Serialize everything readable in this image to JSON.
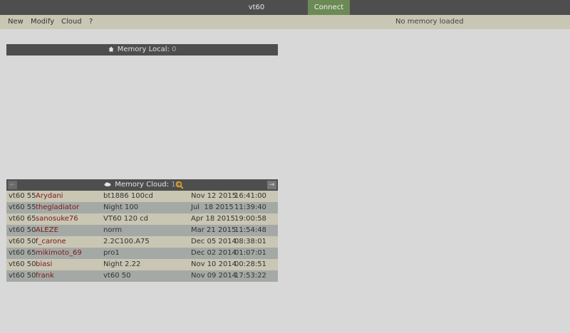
{
  "title": "vt60",
  "connect_label": "Connect",
  "menu": {
    "items": [
      "New",
      "Modify",
      "Cloud",
      "?"
    ],
    "status": "No memory loaded"
  },
  "memory_local": {
    "label": "Memory Local:",
    "count": "0",
    "icon": "home-icon"
  },
  "memory_cloud": {
    "label": "Memory Cloud:",
    "count": "11",
    "icon": "cloud-icon",
    "prev_label": "←",
    "next_label": "→",
    "search_icon_color": "#e8a020",
    "rows": [
      {
        "model": "vt60 55",
        "user": "Arydani",
        "calibration": "bt1886 100cd",
        "date": "Nov 12 2015",
        "time": "16:41:00"
      },
      {
        "model": "vt60 55",
        "user": "thegladiator",
        "calibration": "Night 100",
        "date": "Jul  18 2015",
        "time": "11:39:40"
      },
      {
        "model": "vt60 65",
        "user": "sanosuke76",
        "calibration": "VT60 120 cd",
        "date": "Apr 18 2015",
        "time": "19:00:58"
      },
      {
        "model": "vt60 50",
        "user": "ALEZE",
        "calibration": "norm",
        "date": "Mar 21 2015",
        "time": "11:54:48"
      },
      {
        "model": "vt60 50",
        "user": "f_carone",
        "calibration": "2.2C100.A75",
        "date": "Dec 05 2014",
        "time": "08:38:01"
      },
      {
        "model": "vt60 65",
        "user": "mikimoto_69",
        "calibration": "pro1",
        "date": "Dec 02 2014",
        "time": "01:07:01"
      },
      {
        "model": "vt60 50",
        "user": "biasi",
        "calibration": "Night 2.22",
        "date": "Nov 10 2014",
        "time": "00:28:51"
      },
      {
        "model": "vt60 50",
        "user": "frank",
        "calibration": "vt60 50",
        "date": "Nov 09 2014",
        "time": "17:53:22"
      }
    ]
  },
  "colors": {
    "topbar": "#4e4e4e",
    "connect": "#6b8a55",
    "menubar": "#c9c6b4",
    "row_odd": "#c9c6b4",
    "row_even": "#a5a9a5",
    "username": "#7a1a1a"
  }
}
